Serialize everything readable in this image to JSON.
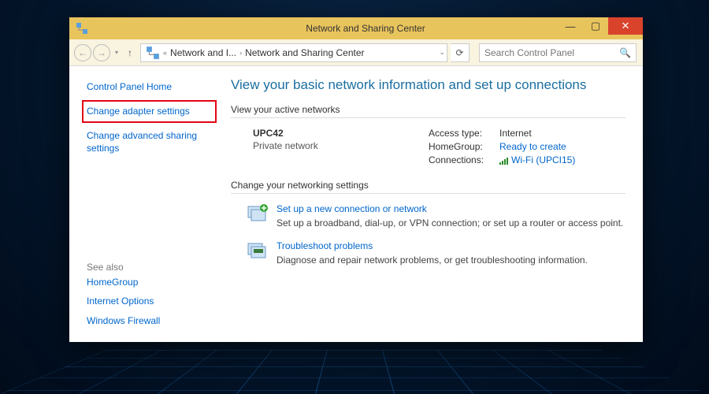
{
  "window": {
    "title": "Network and Sharing Center"
  },
  "toolbar": {
    "crumb1": "Network and I...",
    "crumb2": "Network and Sharing Center",
    "search_placeholder": "Search Control Panel"
  },
  "sidebar": {
    "home": "Control Panel Home",
    "adapter": "Change adapter settings",
    "advanced": "Change advanced sharing settings",
    "see_also": "See also",
    "homegroup": "HomeGroup",
    "internet": "Internet Options",
    "firewall": "Windows Firewall"
  },
  "main": {
    "heading": "View your basic network information and set up connections",
    "active_head": "View your active networks",
    "net_name": "UPC42",
    "net_type": "Private network",
    "access_label": "Access type:",
    "access_val": "Internet",
    "hg_label": "HomeGroup:",
    "hg_val": "Ready to create",
    "conn_label": "Connections:",
    "conn_val": "Wi-Fi (UPCI15)",
    "change_head": "Change your networking settings",
    "setup_title": "Set up a new connection or network",
    "setup_desc": "Set up a broadband, dial-up, or VPN connection; or set up a router or access point.",
    "trouble_title": "Troubleshoot problems",
    "trouble_desc": "Diagnose and repair network problems, or get troubleshooting information."
  }
}
